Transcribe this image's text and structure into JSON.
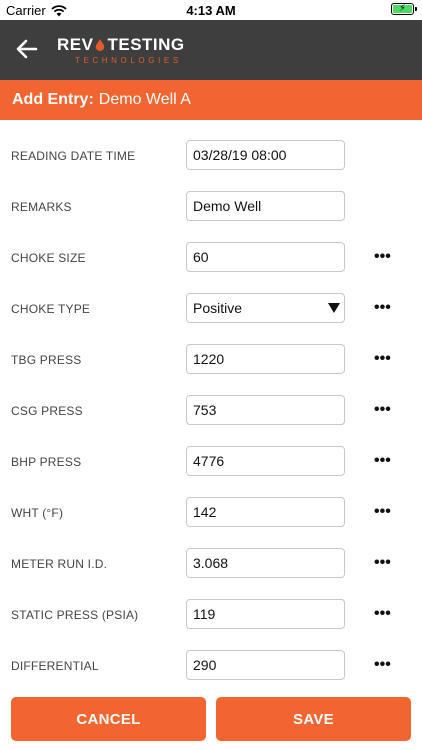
{
  "status": {
    "carrier": "Carrier",
    "time": "4:13 AM"
  },
  "header": {
    "logo_main_left": "REV",
    "logo_main_right": "TESTING",
    "logo_sub": "TECHNOLOGIES",
    "back_icon": "arrow-left-icon"
  },
  "title": {
    "label": "Add Entry:",
    "value": "Demo Well A"
  },
  "colors": {
    "accent": "#f26430",
    "header_bg": "#3e3e3e"
  },
  "fields": [
    {
      "label": "READING DATE TIME",
      "value": "03/28/19 08:00",
      "more": ""
    },
    {
      "label": "REMARKS",
      "value": "Demo Well",
      "more": ""
    },
    {
      "label": "CHOKE SIZE",
      "value": "60",
      "more": "•••"
    },
    {
      "label": "CHOKE TYPE",
      "value": "Positive",
      "more": "•••"
    },
    {
      "label": "TBG PRESS",
      "value": "1220",
      "more": "•••"
    },
    {
      "label": "CSG PRESS",
      "value": "753",
      "more": "•••"
    },
    {
      "label": "BHP PRESS",
      "value": "4776",
      "more": "•••"
    },
    {
      "label": "WHT (°F)",
      "value": "142",
      "more": "•••"
    },
    {
      "label": "METER RUN I.D.",
      "value": "3.068",
      "more": "•••"
    },
    {
      "label": "STATIC PRESS (PSIA)",
      "value": "119",
      "more": "•••"
    },
    {
      "label": "DIFFERENTIAL",
      "value": "290",
      "more": "•••"
    }
  ],
  "actions": {
    "cancel": "CANCEL",
    "save": "SAVE"
  }
}
